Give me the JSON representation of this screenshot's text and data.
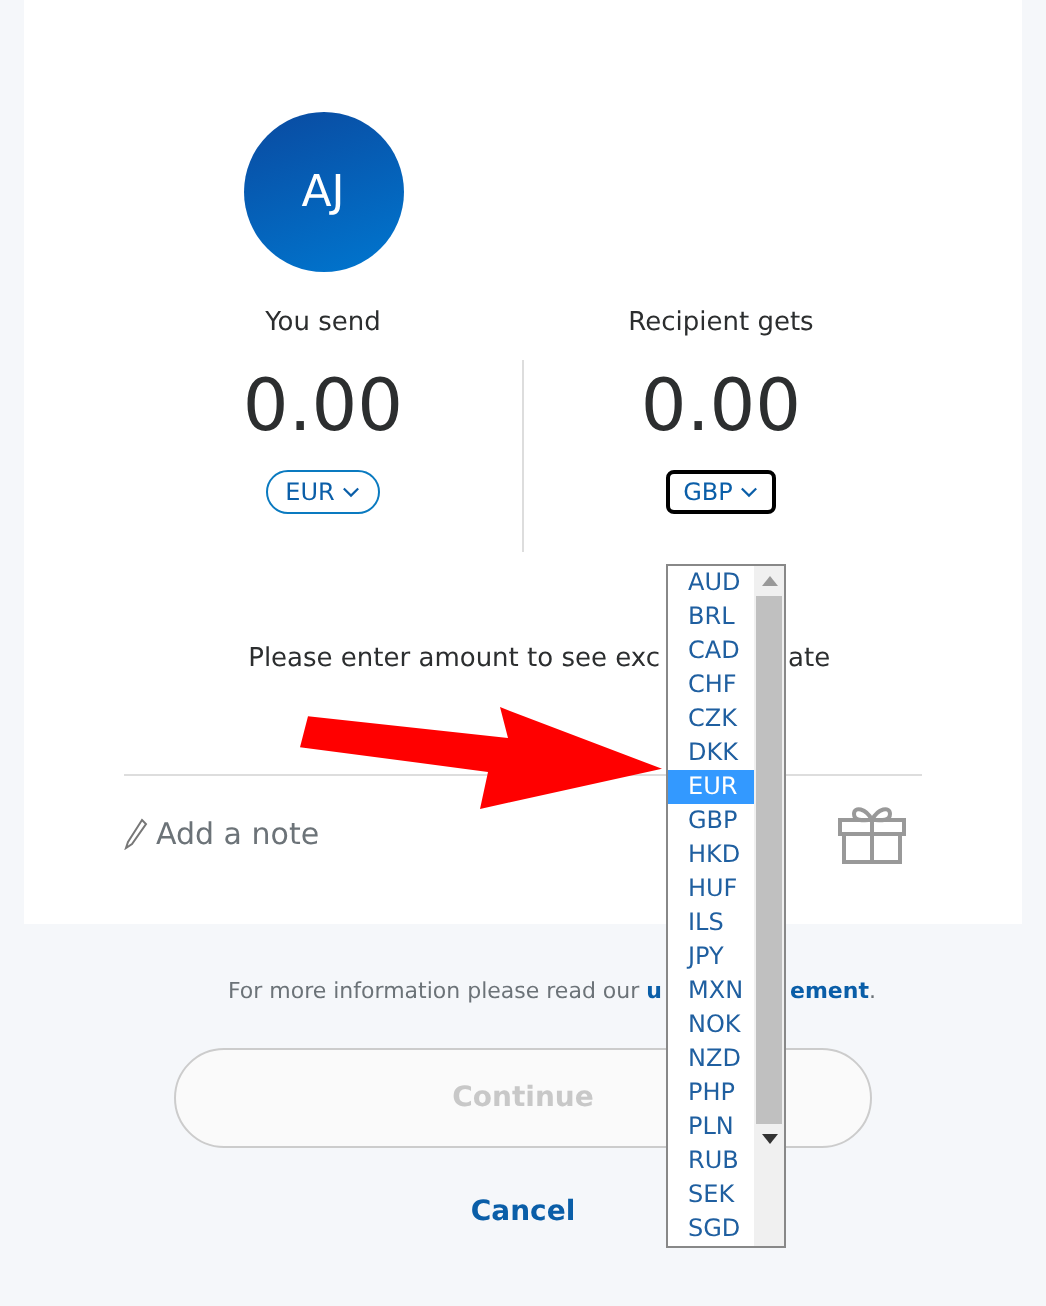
{
  "avatar": {
    "initials": "AJ"
  },
  "send": {
    "label": "You send",
    "amount": "0.00",
    "currency": "EUR"
  },
  "receive": {
    "label": "Recipient gets",
    "amount": "0.00",
    "currency": "GBP"
  },
  "currency_list": [
    {
      "code": "AUD",
      "selected": false
    },
    {
      "code": "BRL",
      "selected": false
    },
    {
      "code": "CAD",
      "selected": false
    },
    {
      "code": "CHF",
      "selected": false
    },
    {
      "code": "CZK",
      "selected": false
    },
    {
      "code": "DKK",
      "selected": false
    },
    {
      "code": "EUR",
      "selected": true
    },
    {
      "code": "GBP",
      "selected": false
    },
    {
      "code": "HKD",
      "selected": false
    },
    {
      "code": "HUF",
      "selected": false
    },
    {
      "code": "ILS",
      "selected": false
    },
    {
      "code": "JPY",
      "selected": false
    },
    {
      "code": "MXN",
      "selected": false
    },
    {
      "code": "NOK",
      "selected": false
    },
    {
      "code": "NZD",
      "selected": false
    },
    {
      "code": "PHP",
      "selected": false
    },
    {
      "code": "PLN",
      "selected": false
    },
    {
      "code": "RUB",
      "selected": false
    },
    {
      "code": "SEK",
      "selected": false
    },
    {
      "code": "SGD",
      "selected": false
    }
  ],
  "message_parts": [
    "Please enter amount to see exc",
    "ate"
  ],
  "note": {
    "placeholder": "Add a note"
  },
  "footer": {
    "text": "For more information please read our",
    "link_start": "u",
    "link_end": "ement",
    "end": "."
  },
  "continue_button": {
    "label": "Continue",
    "disabled": true
  },
  "cancel_link": "Cancel"
}
